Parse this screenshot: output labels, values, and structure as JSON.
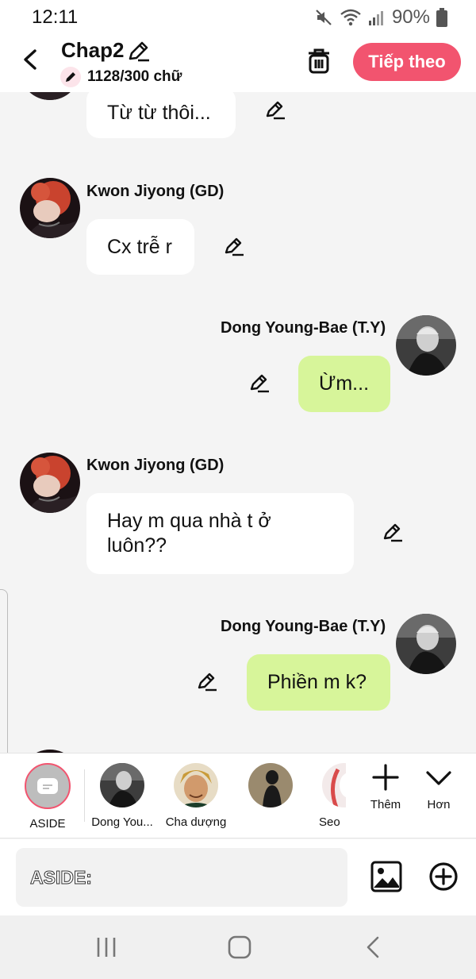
{
  "status_bar": {
    "time": "12:11",
    "battery": "90%",
    "icons": [
      "mute-icon",
      "wifi-icon",
      "signal-icon",
      "battery-icon"
    ]
  },
  "header": {
    "title": "Chap2",
    "word_count": "1128/300 chữ",
    "next_label": "Tiếp theo",
    "accent": "#f2546f"
  },
  "messages": [
    {
      "side": "left",
      "name": "",
      "text": "Từ từ thôi..."
    },
    {
      "side": "left",
      "name": "Kwon Jiyong (GD)",
      "text": "Cx trễ r"
    },
    {
      "side": "right",
      "name": "Dong Young-Bae (T.Y)",
      "text": "Ừm..."
    },
    {
      "side": "left",
      "name": "Kwon Jiyong (GD)",
      "text": "Hay m qua nhà t ở luôn??"
    },
    {
      "side": "right",
      "name": "Dong Young-Bae (T.Y)",
      "text": "Phiền m k?"
    }
  ],
  "characters": [
    {
      "label": "ASIDE",
      "selected": true
    },
    {
      "label": "Dong You..."
    },
    {
      "label": "Cha dượng"
    },
    {
      "label": ""
    },
    {
      "label": "Seo"
    }
  ],
  "controls": {
    "add_label": "Thêm",
    "more_label": "Hơn"
  },
  "composer": {
    "placeholder": "ASIDE:"
  },
  "colors": {
    "bubble_right": "#d7f59a",
    "bubble_left": "#ffffff",
    "background": "#f4f4f4"
  }
}
